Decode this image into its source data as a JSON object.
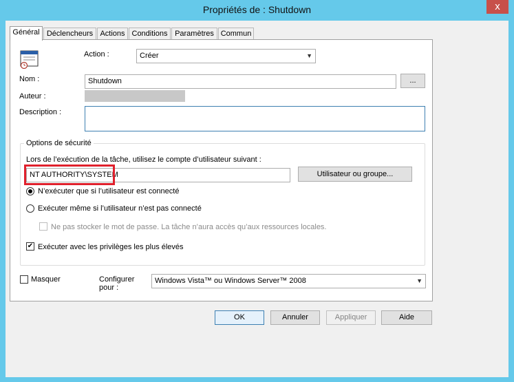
{
  "window": {
    "title": "Propriétés de : Shutdown",
    "close_label": "x"
  },
  "tabs": [
    {
      "label": "Général"
    },
    {
      "label": "Déclencheurs"
    },
    {
      "label": "Actions"
    },
    {
      "label": "Conditions"
    },
    {
      "label": "Paramètres"
    },
    {
      "label": "Commun"
    }
  ],
  "general": {
    "action_label": "Action :",
    "action_value": "Créer",
    "name_label": "Nom :",
    "name_value": "Shutdown",
    "browse_label": "...",
    "author_label": "Auteur :",
    "description_label": "Description :",
    "description_value": ""
  },
  "security": {
    "group_title": "Options de sécurité",
    "run_as_text": "Lors de l’exécution de la tâche, utilisez le compte d’utilisateur suivant :",
    "account_value": "NT AUTHORITY\\SYSTEM",
    "user_group_button": "Utilisateur ou groupe...",
    "radio_logged_on": "N’exécuter que si l’utilisateur est connecté",
    "radio_logged_on_selected": true,
    "radio_always": "Exécuter même si l’utilisateur n’est pas connecté",
    "no_store_password": "Ne pas stocker le mot de passe. La tâche n’aura accès qu’aux ressources locales.",
    "highest_privileges": "Exécuter avec les privilèges les plus élevés",
    "highest_privileges_checked": true
  },
  "bottom": {
    "hidden_label": "Masquer",
    "configure_label_line1": "Configurer",
    "configure_label_line2": "pour :",
    "configure_value": "Windows Vista™ ou Windows Server™ 2008"
  },
  "buttons": {
    "ok": "OK",
    "cancel": "Annuler",
    "apply": "Appliquer",
    "help": "Aide"
  },
  "colors": {
    "titlebar": "#65c9ea",
    "highlight_box": "#e0202c",
    "close_button": "#c7504a"
  }
}
